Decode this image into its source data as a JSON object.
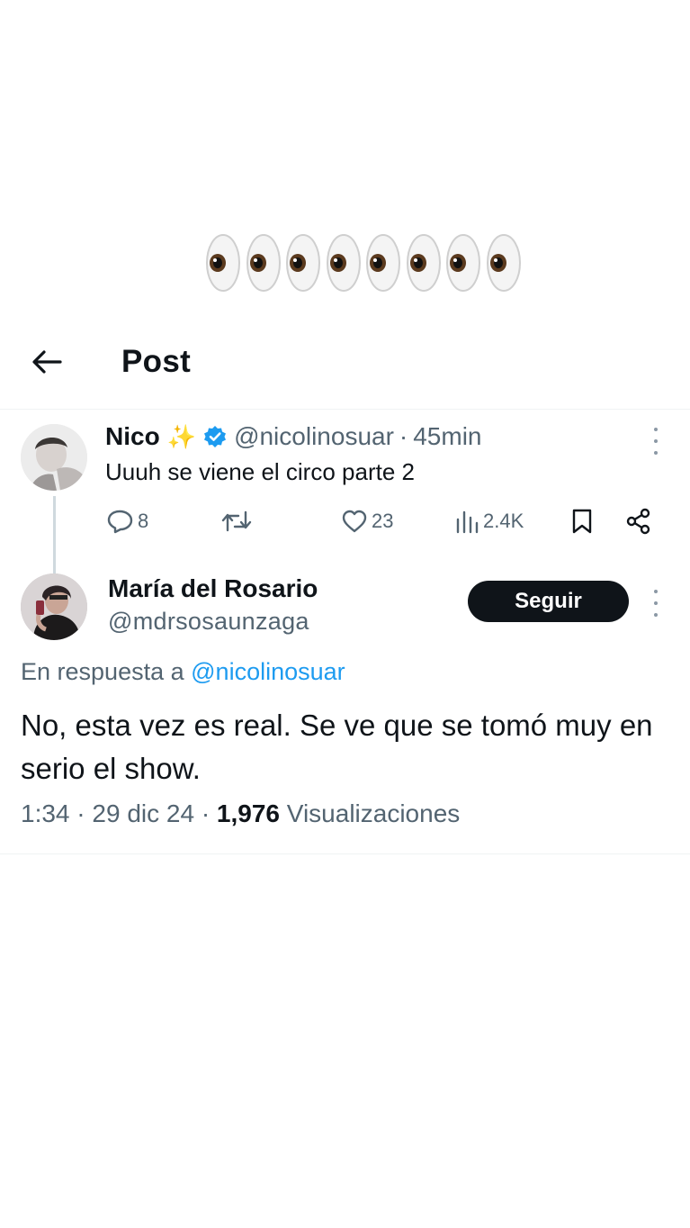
{
  "header": {
    "title": "Post"
  },
  "eyes_row": {
    "count": 8,
    "icon": "eyes-emoji-icon"
  },
  "parent_tweet": {
    "author_name": "Nico",
    "author_emoji": "✨",
    "handle": "@nicolinosuar",
    "separator": "·",
    "time": "45min",
    "text": "Uuuh se viene el circo parte 2",
    "replies": "8",
    "retweets": "",
    "likes": "23",
    "views": "2.4K",
    "verified_color": "#1d9bf0"
  },
  "reply_tweet": {
    "author_name": "María del Rosario",
    "handle": "@mdrsosaunzaga",
    "follow_label": "Seguir",
    "in_reply_prefix": "En respuesta a",
    "in_reply_mention": "@nicolinosuar",
    "text": "No, esta vez es real. Se ve que se tomó muy en serio el show.",
    "time": "1:34",
    "date": "29 dic 24",
    "views_count": "1,976",
    "views_label": "Visualizaciones",
    "separator": "·"
  },
  "colors": {
    "accent": "#1d9bf0",
    "text": "#0f1419",
    "muted": "#536471",
    "button_bg": "#0f1419"
  }
}
